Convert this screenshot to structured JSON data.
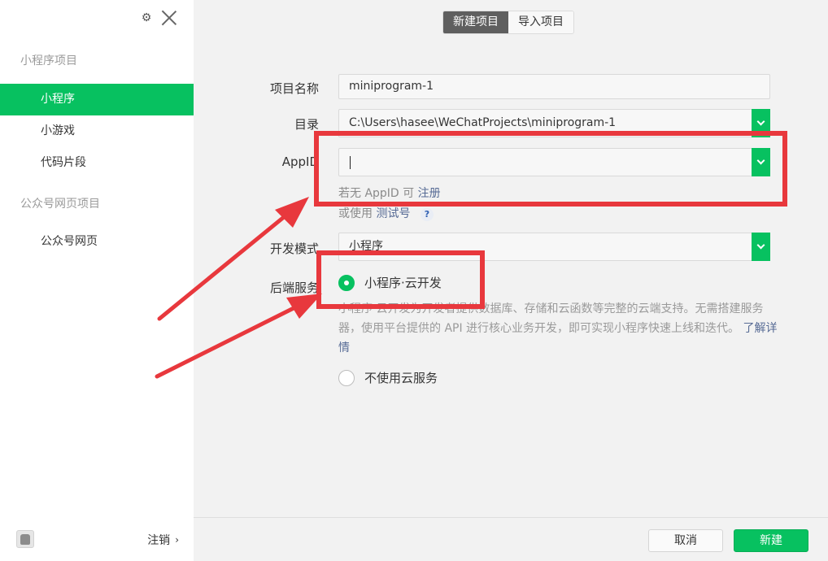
{
  "sidebar": {
    "section_miniprogram": "小程序项目",
    "items": [
      {
        "label": "小程序"
      },
      {
        "label": "小游戏"
      },
      {
        "label": "代码片段"
      }
    ],
    "section_official": "公众号网页项目",
    "official_item": "公众号网页",
    "logout": "注销"
  },
  "tabs": {
    "new_project": "新建项目",
    "import_project": "导入项目"
  },
  "form": {
    "name_label": "项目名称",
    "name_value": "miniprogram-1",
    "dir_label": "目录",
    "dir_value": "C:\\Users\\hasee\\WeChatProjects\\miniprogram-1",
    "appid_label": "AppID",
    "appid_value": "",
    "hint_no_appid_prefix": "若无 AppID 可",
    "hint_register": "注册",
    "hint_or_use": "或使用",
    "hint_test_account": "测试号",
    "help": "?",
    "mode_label": "开发模式",
    "mode_value": "小程序",
    "backend_label": "后端服务",
    "backend_cloud": "小程序·云开发",
    "backend_desc": "小程序·云开发为开发者提供数据库、存储和云函数等完整的云端支持。无需搭建服务器，使用平台提供的 API 进行核心业务开发，即可实现小程序快速上线和迭代。",
    "backend_more": "了解详情",
    "backend_none": "不使用云服务"
  },
  "footer": {
    "cancel": "取消",
    "create": "新建"
  },
  "colors": {
    "accent": "#07c160",
    "annotation": "#e8383d",
    "link": "#576b95"
  }
}
